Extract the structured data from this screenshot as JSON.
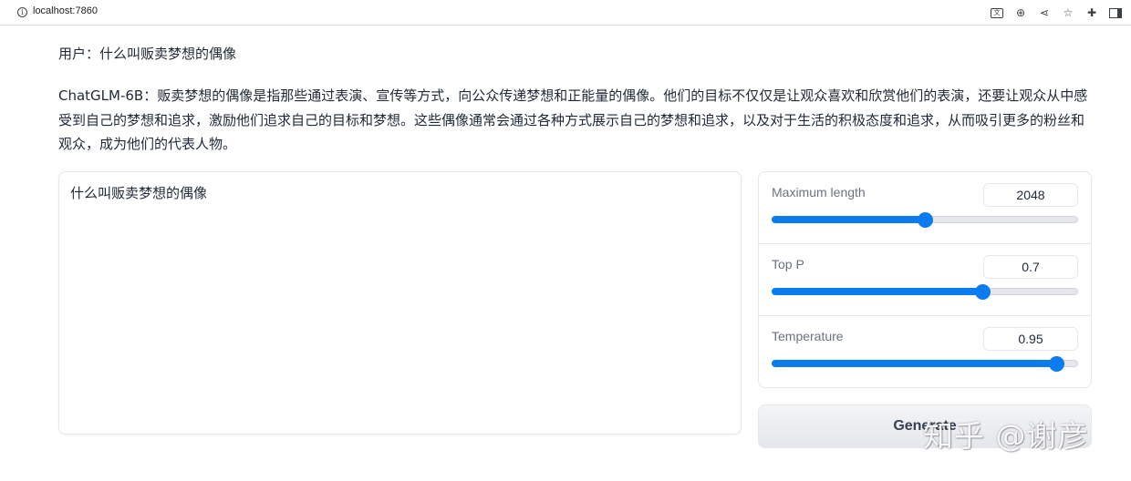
{
  "browser": {
    "url": "localhost:7860",
    "icons": [
      "translate-icon",
      "zoom-icon",
      "share-icon",
      "star-icon",
      "extensions-icon",
      "sidepanel-icon"
    ]
  },
  "chat": {
    "user_message": "用户：什么叫贩卖梦想的偶像",
    "bot_message": "ChatGLM-6B：贩卖梦想的偶像是指那些通过表演、宣传等方式，向公众传递梦想和正能量的偶像。他们的目标不仅仅是让观众喜欢和欣赏他们的表演，还要让观众从中感受到自己的梦想和追求，激励他们追求自己的目标和梦想。这些偶像通常会通过各种方式展示自己的梦想和追求，以及对于生活的积极态度和追求，从而吸引更多的粉丝和观众，成为他们的代表人物。"
  },
  "input": {
    "value": "什么叫贩卖梦想的偶像"
  },
  "sliders": [
    {
      "label": "Maximum length",
      "value": "2048",
      "fraction": 0.5
    },
    {
      "label": "Top P",
      "value": "0.7",
      "fraction": 0.69
    },
    {
      "label": "Temperature",
      "value": "0.95",
      "fraction": 0.93
    }
  ],
  "generate_label": "Generate",
  "watermark": "知乎 @谢彦",
  "colors": {
    "accent": "#0b7bf0"
  }
}
